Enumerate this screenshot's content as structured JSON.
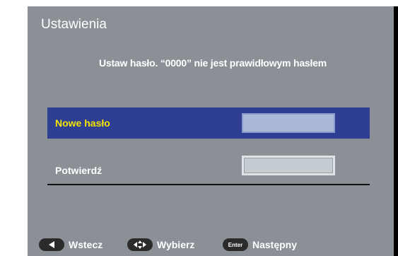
{
  "screen": {
    "title": "Ustawienia",
    "message": "Ustaw hasło. “0000” nie jest prawidłowym hasłem"
  },
  "fields": {
    "new_password": {
      "label": "Nowe hasło",
      "value": ""
    },
    "confirm": {
      "label": "Potwierdź",
      "value": ""
    }
  },
  "footer": {
    "back_label": "Wstecz",
    "select_label": "Wybierz",
    "next_label": "Następny",
    "enter_key_label": "Enter",
    "back_icon": "left-arrow-icon",
    "select_icon": "directional-pad-icon"
  },
  "colors": {
    "background": "#8a9096",
    "highlight_row": "#2e3e93",
    "highlight_label": "#f5e400",
    "text": "#ffffff"
  }
}
